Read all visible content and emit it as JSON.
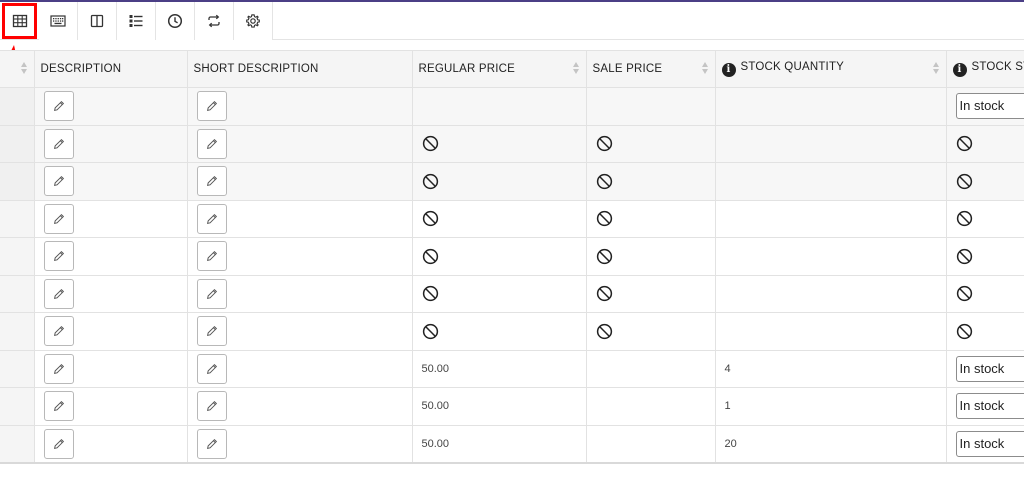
{
  "toolbar": {
    "buttons": [
      {
        "icon": "table-icon",
        "active": true
      },
      {
        "icon": "keyboard-icon",
        "active": false
      },
      {
        "icon": "columns-icon",
        "active": false
      },
      {
        "icon": "list-icon",
        "active": false
      },
      {
        "icon": "clock-icon",
        "active": false
      },
      {
        "icon": "repeat-icon",
        "active": false
      },
      {
        "icon": "gear-icon",
        "active": false
      }
    ]
  },
  "colors": {
    "highlight": "#ff0000",
    "top_border": "#4b3f86"
  },
  "table": {
    "headers": {
      "description": "DESCRIPTION",
      "short_description": "SHORT DESCRIPTION",
      "regular_price": "REGULAR PRICE",
      "sale_price": "SALE PRICE",
      "stock_quantity": "STOCK QUANTITY",
      "stock_status": "STOCK ST"
    },
    "rows": [
      {
        "regular_price": "",
        "sale_price": "",
        "stock_quantity": "",
        "stock_status": "In stock",
        "price_blocked": false,
        "status_blocked": false
      },
      {
        "regular_price": "",
        "sale_price": "",
        "stock_quantity": "",
        "stock_status": "",
        "price_blocked": true,
        "status_blocked": true
      },
      {
        "regular_price": "",
        "sale_price": "",
        "stock_quantity": "",
        "stock_status": "",
        "price_blocked": true,
        "status_blocked": true
      },
      {
        "regular_price": "",
        "sale_price": "",
        "stock_quantity": "",
        "stock_status": "",
        "price_blocked": true,
        "status_blocked": true
      },
      {
        "regular_price": "",
        "sale_price": "",
        "stock_quantity": "",
        "stock_status": "",
        "price_blocked": true,
        "status_blocked": true
      },
      {
        "regular_price": "",
        "sale_price": "",
        "stock_quantity": "",
        "stock_status": "",
        "price_blocked": true,
        "status_blocked": true
      },
      {
        "regular_price": "",
        "sale_price": "",
        "stock_quantity": "",
        "stock_status": "",
        "price_blocked": true,
        "status_blocked": true
      },
      {
        "regular_price": "50.00",
        "sale_price": "",
        "stock_quantity": "4",
        "stock_status": "In stock",
        "price_blocked": false,
        "status_blocked": false
      },
      {
        "regular_price": "50.00",
        "sale_price": "",
        "stock_quantity": "1",
        "stock_status": "In stock",
        "price_blocked": false,
        "status_blocked": false
      },
      {
        "regular_price": "50.00",
        "sale_price": "",
        "stock_quantity": "20",
        "stock_status": "In stock",
        "price_blocked": false,
        "status_blocked": false
      }
    ]
  }
}
